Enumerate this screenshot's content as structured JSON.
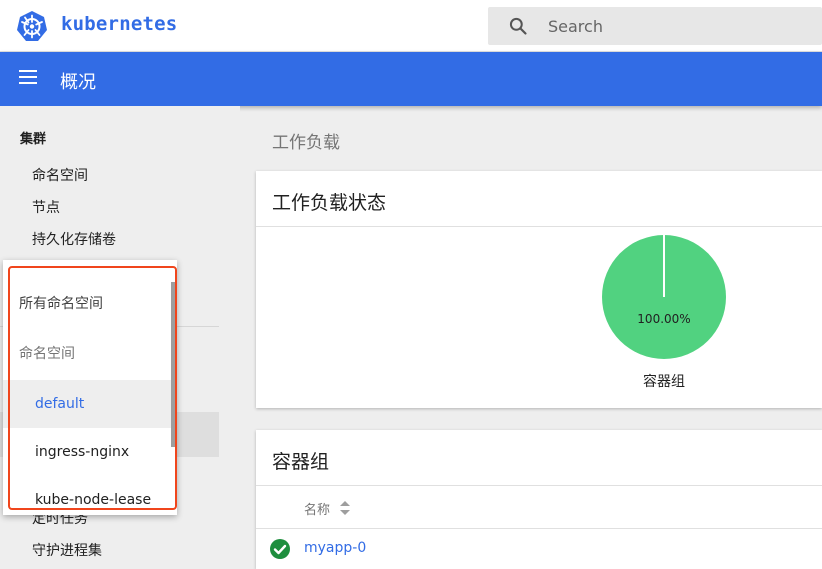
{
  "header": {
    "brand": "kubernetes",
    "search_placeholder": "Search"
  },
  "titlebar": {
    "title": "概况"
  },
  "sidebar": {
    "section": "集群",
    "items": [
      "命名空间",
      "节点",
      "持久化存储卷"
    ],
    "lower_items": [
      "定时任务",
      "守护进程集"
    ]
  },
  "namespace_dropdown": {
    "all_label": "所有命名空间",
    "group_label": "命名空间",
    "options": [
      "default",
      "ingress-nginx",
      "kube-node-lease"
    ],
    "selected": "default"
  },
  "main": {
    "heading": "工作负载",
    "status_card": {
      "title": "工作负载状态",
      "chart_label": "容器组"
    },
    "pods_card": {
      "title": "容器组",
      "column_name": "名称",
      "rows": [
        {
          "name": "myapp-0",
          "status": "running"
        }
      ]
    }
  },
  "chart_data": {
    "type": "pie",
    "title": "容器组",
    "slices": [
      {
        "label": "100.00%",
        "value": 100,
        "color": "#51d280"
      }
    ]
  },
  "colors": {
    "brand": "#326ce5",
    "pie_green": "#51d280",
    "success_green": "#1e8e3e",
    "highlight_red": "#f0451c"
  },
  "icons": {
    "logo": "kubernetes-helm-icon",
    "search": "search-icon",
    "menu": "hamburger-icon",
    "sort": "sort-arrows-icon",
    "status": "check-circle-icon"
  }
}
